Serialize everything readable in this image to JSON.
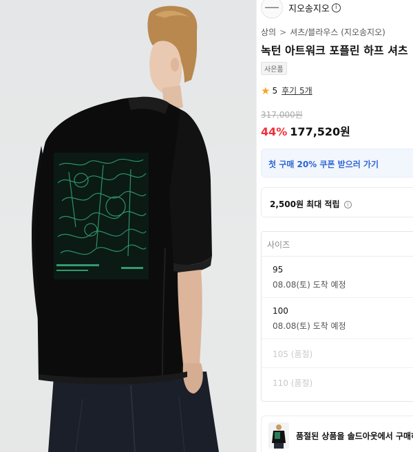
{
  "brand": {
    "name": "지오송지오",
    "info_icon": "ⓘ"
  },
  "breadcrumb": {
    "level1": "상의",
    "separator": ">",
    "level2": "셔츠/블라우스 (지오송지오)"
  },
  "product": {
    "title": "녹턴 아트워크 포플린 하프 셔츠",
    "gift_tag": "사은품",
    "rating": "5",
    "review_link": "후기 5개",
    "original_price": "317,000원",
    "discount": "44%",
    "price": "177,520원"
  },
  "coupon": {
    "label": "첫 구매 20% 쿠폰 받으러 가기"
  },
  "points": {
    "label": "2,500원 최대 적립",
    "info_icon": "i"
  },
  "size_select": {
    "placeholder": "사이즈",
    "options": [
      {
        "name": "95",
        "delivery": "08.08(토) 도착 예정"
      },
      {
        "name": "100",
        "delivery": "08.08(토) 도착 예정"
      },
      {
        "name": "105 (품절)"
      },
      {
        "name": "110 (품절)"
      }
    ]
  },
  "soldout_banner": {
    "label": "품절된 상품을 솔드아웃에서 구매하"
  },
  "colors": {
    "discount_red": "#f1303a",
    "coupon_blue": "#2c64d6",
    "star_yellow": "#f5a623",
    "print_green": "#2f9a6e"
  },
  "icons": {
    "star": "star-icon",
    "info": "info-icon"
  }
}
